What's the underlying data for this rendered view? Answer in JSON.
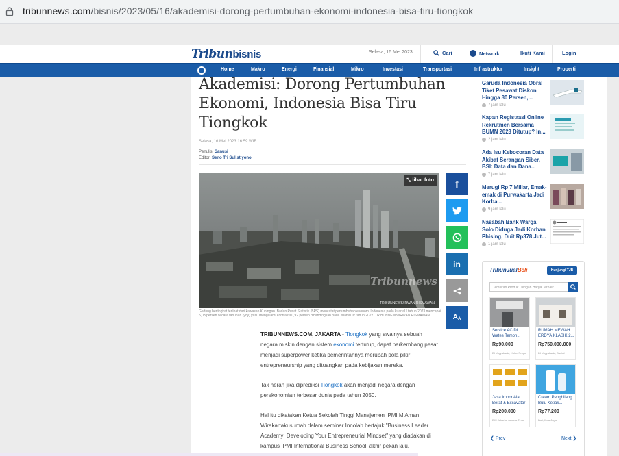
{
  "browser": {
    "url_domain": "tribunnews.com",
    "url_path": "/bisnis/2023/05/16/akademisi-dorong-pertumbuhan-ekonomi-indonesia-bisa-tiru-tiongkok"
  },
  "header": {
    "logo_tribun": "Tribun",
    "logo_section": "bisnis",
    "date": "Selasa, 16 Mei 2023",
    "search_label": "Cari",
    "network_label": "Network",
    "follow_label": "Ikuti Kami",
    "login_label": "Login"
  },
  "nav": {
    "items": [
      "Home",
      "Makro",
      "Energi",
      "Finansial",
      "Mikro",
      "Investasi",
      "Transportasi",
      "Infrastruktur",
      "Insight",
      "Properti"
    ]
  },
  "article": {
    "title": "Akademisi: Dorong Pertumbuhan Ekonomi, Indonesia Bisa Tiru Tiongkok",
    "datetime": "Selasa, 16 Mei 2023 16:59 WIB",
    "writer_label": "Penulis:",
    "writer": "Sanusi",
    "editor_label": "Editor:",
    "editor": "Seno Tri Sulistiyono",
    "photo_button": "lihat foto",
    "photo_credit": "TRIBUNNEWS/IRWAN RISMAWAN",
    "photo_watermark": "Tribunnews",
    "caption": "Gedung bertingkat terlihat dari kawasan Kuningan. Badan Pusat Statistik (BPS) mencatat pertumbuhan ekonomi Indonesia pada kuartal I tahun 2023 mencapai 5,03 persen secara tahunan (yoy) yaitu mengalami kontraksi 0,92 persen dibandingkan pada kuartal IV tahun 2022. TRIBUNNEWS/IRWAN RISMAWAN",
    "p1_dateline": "TRIBUNNEWS.COM, JAKARTA - ",
    "p1_link1": "Tiongkok",
    "p1_text1": " yang awalnya sebuah negara miskin dengan sistem ",
    "p1_link2": "ekonomi",
    "p1_text2": " tertutup, dapat berkembang pesat menjadi superpower ketika pemerintahnya merubah pola pikir entrepreneurship yang dituangkan pada kebijakan mereka.",
    "p2_text1": "Tak heran jika diprediksi ",
    "p2_link": "Tiongkok",
    "p2_text2": " akan menjadi negara dengan perekonomian terbesar dunia pada tahun 2050.",
    "p3": "Hal itu dikatakan Ketua Sekolah Tinggi Manajemen IPMI M Aman Wirakartakusumah dalam seminar Innolab bertajuk \"Business Leader Academy: Developing Your Entrepreneurial Mindset\" yang diadakan di kampus IPMI International Business School, akhir pekan lalu."
  },
  "share": {
    "facebook": "f",
    "twitter": "twitter-icon",
    "whatsapp": "whatsapp-icon",
    "linkedin": "in",
    "share": "share-icon",
    "fontsize": "A"
  },
  "sidebar": {
    "items": [
      {
        "title": "Garuda Indonesia Obral Tiket Pesawat Diskon Hingga 80 Persen,...",
        "time": "7 jam lalu"
      },
      {
        "title": "Kapan Registrasi Online Rekrutmen Bersama BUMN 2023 Ditutup? In...",
        "time": "2 jam lalu"
      },
      {
        "title": "Ada Isu Kebocoran Data Akibat Serangan Siber, BSI: Data dan Dana...",
        "time": "7 jam lalu"
      },
      {
        "title": "Merugi Rp 7 Miliar, Emak-emak di Purwakarta Jadi Korba...",
        "time": "9 jam lalu"
      },
      {
        "title": "Nasabah Bank Warga Solo Diduga Jadi Korban Phising, Duit Rp378 Jut...",
        "time": "1 jam lalu"
      }
    ]
  },
  "widget": {
    "logo_a": "TribunJual",
    "logo_b": "Beli",
    "button": "Kunjungi TJB",
    "search_placeholder": "Temukan Produk Dengan Harga Terbaik",
    "products": [
      {
        "name": "Service AC Di Wates Temon...",
        "price": "Rp90.000",
        "loc": "DI Yogyakarta, Kulon Progo"
      },
      {
        "name": "RUMAH MEWAH ERDYA KLASIK 2...",
        "price": "Rp750.000.000",
        "loc": "DI Yogyakarta, Bantul"
      },
      {
        "name": "Jasa Impor Alat Berat & Excavator",
        "price": "Rp200.000",
        "loc": "DKI Jakarta, Jakarta Timur"
      },
      {
        "name": "Cream Penghilang Bulu Ketiak...",
        "price": "Rp77.200",
        "loc": "Bali, Kuta Juga"
      }
    ],
    "prev": "Prev",
    "next": "Next"
  }
}
